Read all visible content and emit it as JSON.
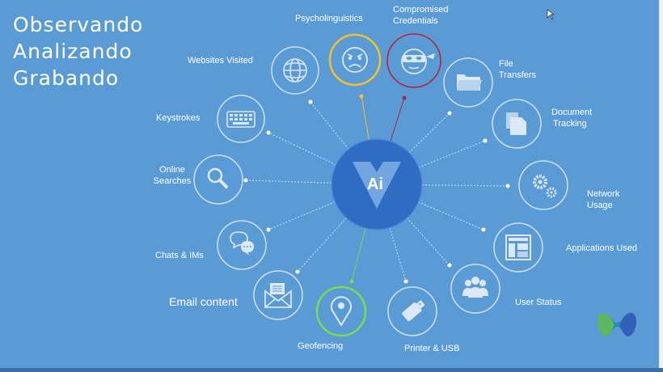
{
  "heading": {
    "line1": "Observando",
    "line2": "Analizando",
    "line3": "Grabando"
  },
  "hub": {
    "text": "Ai"
  },
  "labels": {
    "psycholinguistics": "Psycholinguistics",
    "compromised_1": "Compromised",
    "compromised_2": "Credentials",
    "file_1": "File",
    "file_2": "Transfers",
    "websites": "Websites Visited",
    "document_1": "Document",
    "document_2": "Tracking",
    "keystrokes": "Keystrokes",
    "online_1": "Online",
    "online_2": "Searches",
    "network_1": "Network",
    "network_2": "Usage",
    "applications": "Applications Used",
    "chats": "Chats & IMs",
    "email": "Email content",
    "user_status": "User Status",
    "geofencing": "Geofencing",
    "printer": "Printer & USB"
  },
  "colors": {
    "background": "#5b9bd5",
    "hub": "#2f6cc4",
    "psycholinguistics_ring": "#f2c12e",
    "compromised_ring": "#b0263d",
    "geofencing_ring": "#7ed957"
  }
}
